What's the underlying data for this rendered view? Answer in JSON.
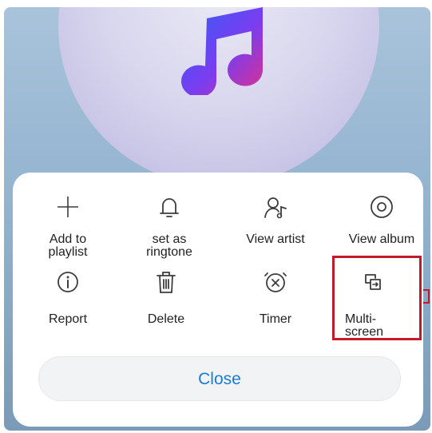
{
  "colors": {
    "accent": "#1a7bd6",
    "highlight": "#c21a2b",
    "icon_stroke": "#3d3d3d"
  },
  "album_art": {
    "icon": "music-note-icon"
  },
  "menu": {
    "items": [
      {
        "label": "Add to\nplaylist",
        "icon": "plus-icon"
      },
      {
        "label": "set as\nringtone",
        "icon": "bell-icon"
      },
      {
        "label": "View artist",
        "icon": "artist-icon"
      },
      {
        "label": "View album",
        "icon": "album-disc-icon"
      },
      {
        "label": "Report",
        "icon": "info-icon"
      },
      {
        "label": "Delete",
        "icon": "trash-icon"
      },
      {
        "label": "Timer",
        "icon": "timer-icon"
      },
      {
        "label": "Multi-\nscreen",
        "icon": "multi-screen-icon"
      }
    ]
  },
  "close_label": "Close"
}
